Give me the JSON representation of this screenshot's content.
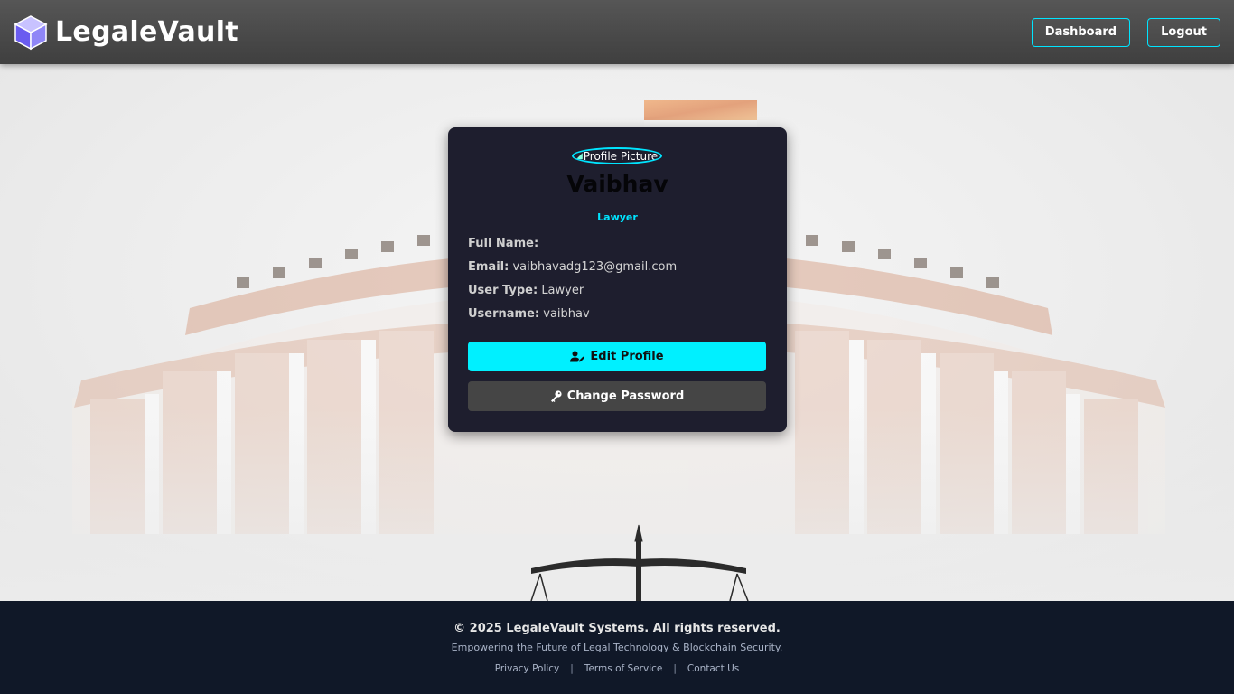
{
  "header": {
    "brand_name": "LegaleVault",
    "logo_icon": "cube-logo-icon",
    "nav": {
      "dashboard_label": "Dashboard",
      "logout_label": "Logout"
    }
  },
  "profile": {
    "avatar_alt": "Profile Picture",
    "name": "Vaibhav",
    "role": "Lawyer",
    "fields": [
      {
        "label": "Full Name:",
        "value": ""
      },
      {
        "label": "Email:",
        "value": "vaibhavadg123@gmail.com"
      },
      {
        "label": "User Type:",
        "value": "Lawyer"
      },
      {
        "label": "Username:",
        "value": "vaibhav"
      }
    ],
    "edit_label": "Edit Profile",
    "edit_icon": "user-edit-icon",
    "password_label": "Change Password",
    "password_icon": "key-icon"
  },
  "footer": {
    "copyright": "© 2025 LegaleVault Systems. All rights reserved.",
    "tagline": "Empowering the Future of Legal Technology & Blockchain Security.",
    "links": [
      "Privacy Policy",
      "Terms of Service",
      "Contact Us"
    ],
    "separator": "|"
  },
  "colors": {
    "accent": "#00e5ff",
    "card_bg": "#1e1e2e",
    "footer_bg": "#101828",
    "header_bg": "#4a4a4a"
  }
}
